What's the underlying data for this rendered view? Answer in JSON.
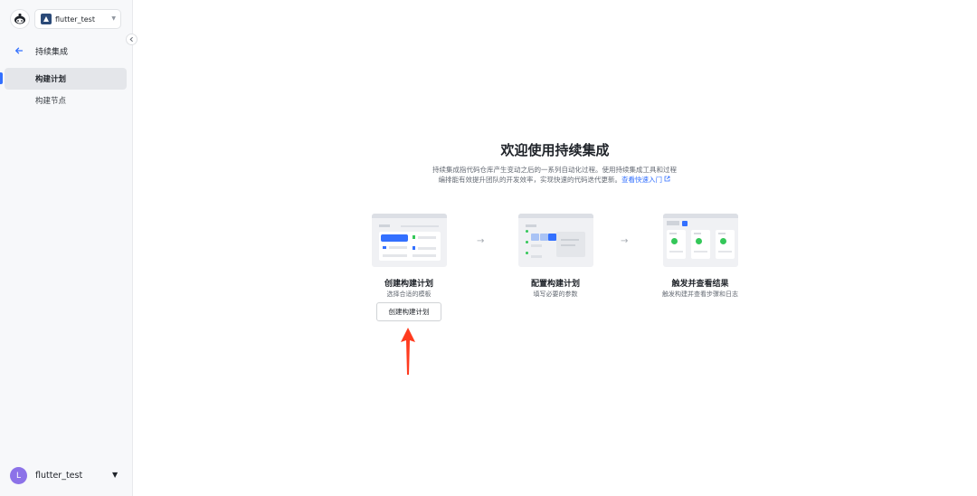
{
  "sidebar": {
    "project_name": "flutter_test",
    "back_label": "持续集成",
    "nav_items": [
      {
        "label": "构建计划",
        "active": true
      },
      {
        "label": "构建节点",
        "active": false
      }
    ],
    "user": {
      "initial": "L",
      "name": "flutter_test"
    }
  },
  "main": {
    "title": "欢迎使用持续集成",
    "description_line1": "持续集成指代码仓库产生变动之后的一系列自动化过程。使用持续集成工具和过程",
    "description_line2": "编排能有效提升团队的开发效率，实现快速的代码迭代更新。",
    "guide_link": "查看快速入门",
    "steps": [
      {
        "title": "创建构建计划",
        "subtitle": "选择合适的模板"
      },
      {
        "title": "配置构建计划",
        "subtitle": "填写必要的参数"
      },
      {
        "title": "触发并查看结果",
        "subtitle": "触发构建并查看步骤和日志"
      }
    ],
    "create_button_label": "创建构建计划"
  },
  "colors": {
    "accent": "#3370ff",
    "success": "#34c759",
    "annotation_arrow": "#ff3b1f",
    "avatar": "#8c72e8"
  }
}
